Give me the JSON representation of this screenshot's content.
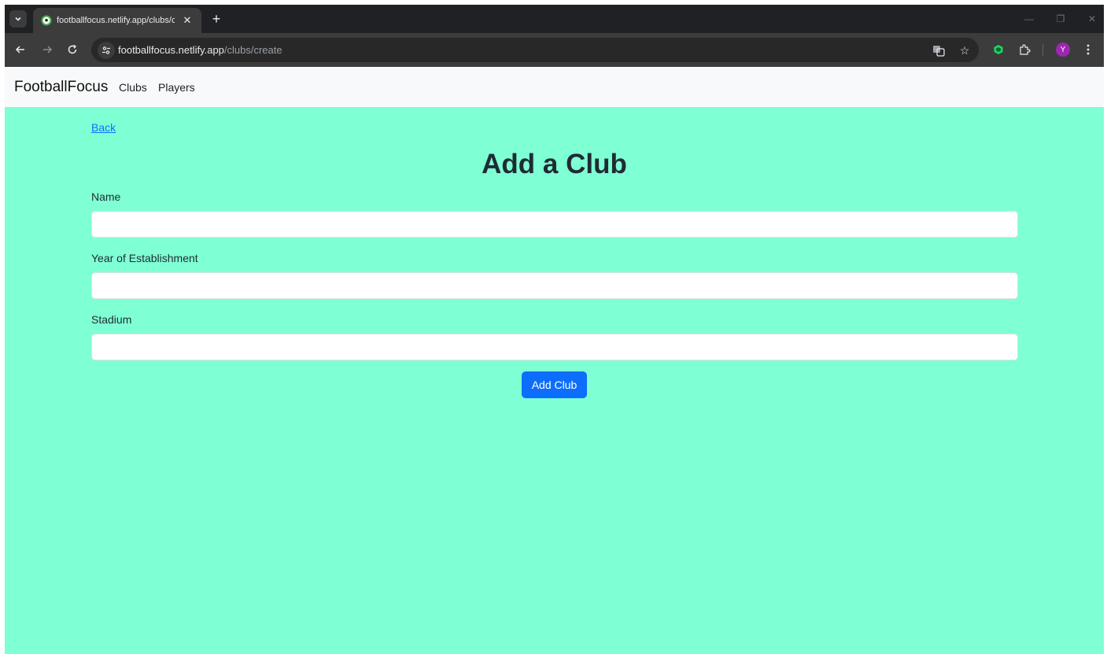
{
  "browser": {
    "tab_title": "footballfocus.netlify.app/clubs/create",
    "url_host": "footballfocus.netlify.app",
    "url_path": "/clubs/create",
    "close_glyph": "✕",
    "new_tab_glyph": "+",
    "profile_initial": "Y",
    "icons": {
      "tab_list": "chevron-down-icon",
      "favicon": "soccer-ball-icon",
      "back": "arrow-left-icon",
      "forward": "arrow-right-icon",
      "reload": "reload-icon",
      "site_info": "tune-icon",
      "translate": "translate-icon",
      "bookmark": "star-icon",
      "extension": "extension-cube-icon",
      "extensions_menu": "puzzle-icon",
      "menu": "more-vert-icon"
    },
    "colors": {
      "tab_bar": "#202124",
      "toolbar": "#3c3c3c",
      "profile": "#9c27b0",
      "extension": "#1ed760"
    }
  },
  "navbar": {
    "brand": "FootballFocus",
    "links": [
      "Clubs",
      "Players"
    ]
  },
  "page": {
    "back_label": "Back",
    "title": "Add a Club",
    "fields": [
      {
        "label": "Name",
        "value": "",
        "placeholder": ""
      },
      {
        "label": "Year of Establishment",
        "value": "",
        "placeholder": ""
      },
      {
        "label": "Stadium",
        "value": "",
        "placeholder": ""
      }
    ],
    "submit_label": "Add Club",
    "colors": {
      "background": "#7fffd4",
      "primary": "#0d6efd",
      "navbar_bg": "#f8f9fa"
    }
  }
}
